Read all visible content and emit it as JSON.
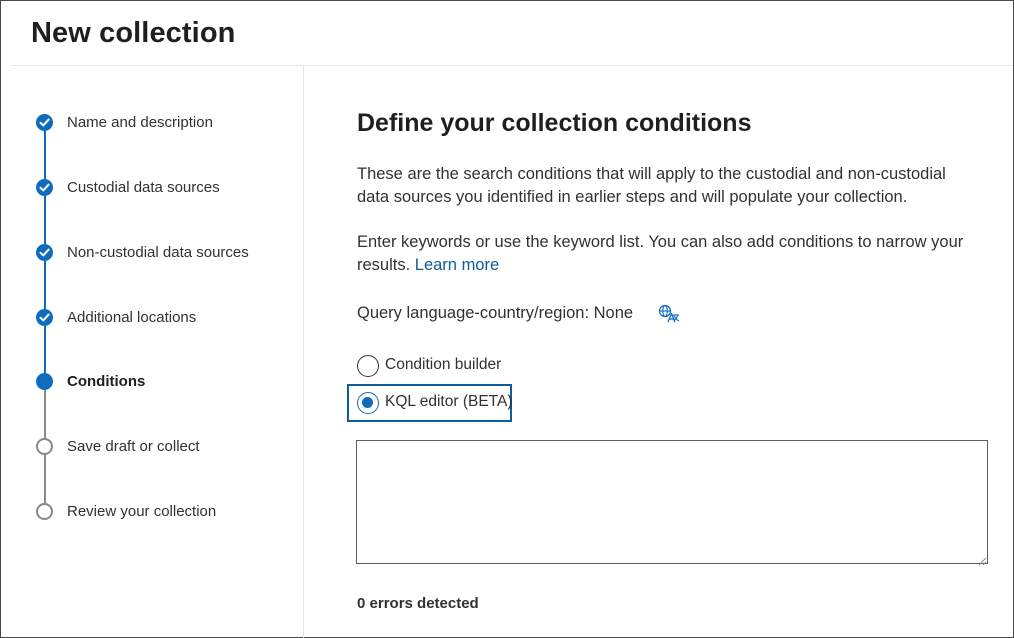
{
  "page": {
    "title": "New collection"
  },
  "steps": [
    {
      "label": "Name and description",
      "state": "done"
    },
    {
      "label": "Custodial data sources",
      "state": "done"
    },
    {
      "label": "Non-custodial data sources",
      "state": "done"
    },
    {
      "label": "Additional locations",
      "state": "done"
    },
    {
      "label": "Conditions",
      "state": "current"
    },
    {
      "label": "Save draft or collect",
      "state": "pending"
    },
    {
      "label": "Review your collection",
      "state": "pending"
    }
  ],
  "main": {
    "heading": "Define your collection conditions",
    "description": "These are the search conditions that will apply to the custodial and non-custodial data sources you identified in earlier steps and will populate your collection.",
    "keywords_text": "Enter keywords or use the keyword list. You can also add conditions to narrow your results.",
    "learn_more": "Learn more",
    "query_language": "Query language-country/region: None",
    "query_language_icon": "translate-icon",
    "options": {
      "condition_builder": "Condition builder",
      "kql_editor": "KQL editor (BETA)",
      "selected": "KQL editor (BETA)"
    },
    "kql_value": "",
    "errors": "0 errors detected"
  },
  "colors": {
    "accent": "#0f6cbd",
    "link": "#0f5c9c",
    "pending": "#8a8886"
  }
}
